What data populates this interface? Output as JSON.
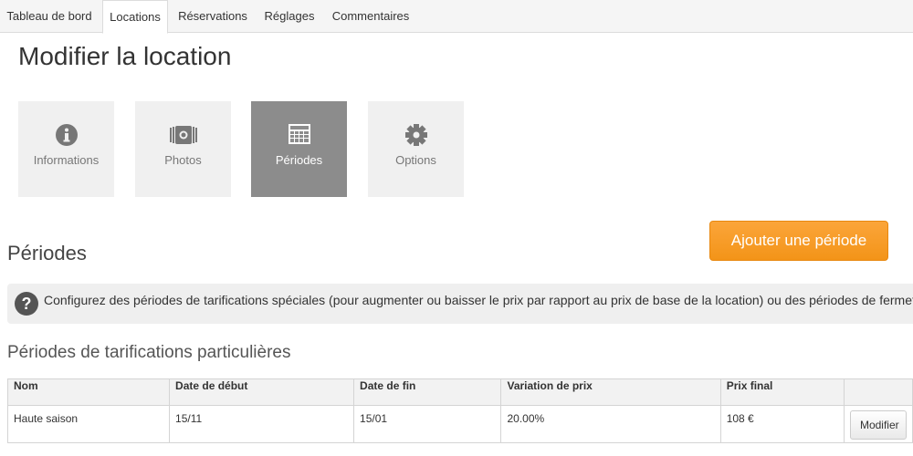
{
  "tabs": [
    {
      "label": "Tableau de bord"
    },
    {
      "label": "Locations"
    },
    {
      "label": "Réservations"
    },
    {
      "label": "Réglages"
    },
    {
      "label": "Commentaires"
    }
  ],
  "page_title": "Modifier la location",
  "steps": [
    {
      "label": "Informations",
      "icon": "info-icon"
    },
    {
      "label": "Photos",
      "icon": "camera-icon"
    },
    {
      "label": "Périodes",
      "icon": "calendar-icon",
      "active": true
    },
    {
      "label": "Options",
      "icon": "gear-icon"
    }
  ],
  "section_title": "Périodes",
  "add_button": "Ajouter une période",
  "help_text": "Configurez des périodes de tarifications spéciales (pour augmenter ou baisser le prix par rapport au prix de base de la location) ou des périodes de fermeture",
  "subsection_title": "Périodes de tarifications particulières",
  "table": {
    "headers": [
      "Nom",
      "Date de début",
      "Date de fin",
      "Variation de prix",
      "Prix final"
    ],
    "rows": [
      {
        "name": "Haute saison",
        "start": "15/11",
        "end": "15/01",
        "variation": "20.00%",
        "final": "108 €",
        "action": "Modifier"
      }
    ]
  },
  "colors": {
    "accent": "#f39418",
    "active_step": "#8c8c8c"
  }
}
